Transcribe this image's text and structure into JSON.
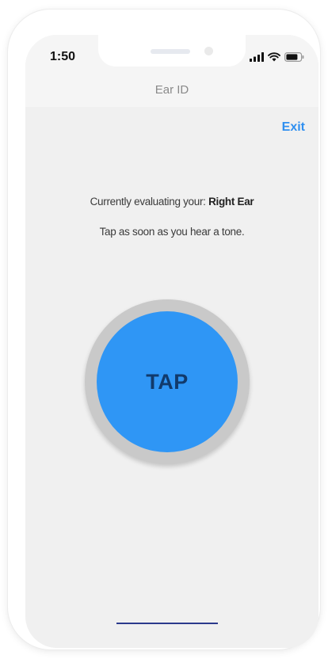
{
  "status_bar": {
    "time": "1:50",
    "icons": [
      "cellular-signal-icon",
      "wifi-icon",
      "battery-icon"
    ]
  },
  "nav": {
    "title": "Ear ID",
    "exit_label": "Exit"
  },
  "prompt": {
    "evaluating_prefix": "Currently evaluating your:",
    "ear": "Right Ear",
    "instruction": "Tap as soon as you hear a tone."
  },
  "tap_button": {
    "label": "TAP"
  },
  "colors": {
    "accent": "#2f8ff0",
    "tap_fill": "#2f96f5",
    "tap_text": "#113a6b",
    "ring": "#c9c9c9",
    "background": "#f0f0f0"
  }
}
